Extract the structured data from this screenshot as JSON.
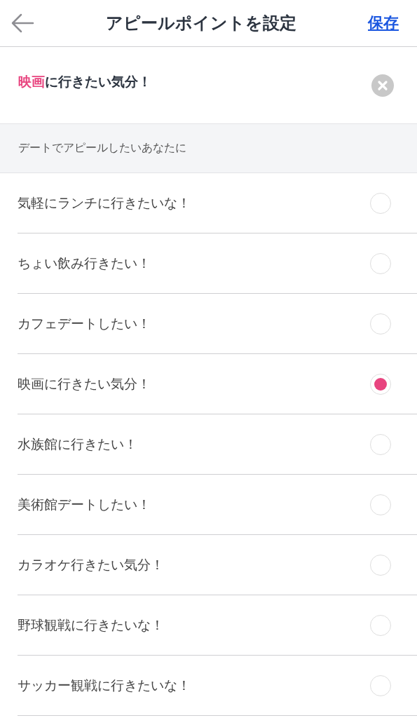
{
  "header": {
    "title": "アピールポイントを設定",
    "save": "保存"
  },
  "current": {
    "text": "**映画**に行きたい気分！"
  },
  "section": {
    "title": "デートでアピールしたいあなたに"
  },
  "options": [
    {
      "label": "気軽にランチに行きたいな！",
      "selected": false
    },
    {
      "label": "ちょい飲み行きたい！",
      "selected": false
    },
    {
      "label": "カフェデートしたい！",
      "selected": false
    },
    {
      "label": "映画に行きたい気分！",
      "selected": true
    },
    {
      "label": "水族館に行きたい！",
      "selected": false
    },
    {
      "label": "美術館デートしたい！",
      "selected": false
    },
    {
      "label": "カラオケ行きたい気分！",
      "selected": false
    },
    {
      "label": "野球観戦に行きたいな！",
      "selected": false
    },
    {
      "label": "サッカー観戦に行きたいな！",
      "selected": false
    }
  ]
}
